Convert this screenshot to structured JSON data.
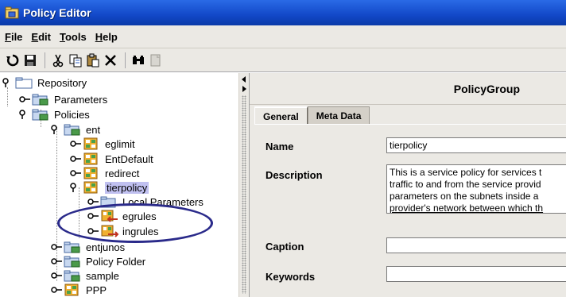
{
  "window": {
    "title": "Policy Editor"
  },
  "menu": [
    {
      "label": "File",
      "accel": "F",
      "rest": "ile"
    },
    {
      "label": "Edit",
      "accel": "E",
      "rest": "dit"
    },
    {
      "label": "Tools",
      "accel": "T",
      "rest": "ools"
    },
    {
      "label": "Help",
      "accel": "H",
      "rest": "elp"
    }
  ],
  "toolbar": {
    "buttons": [
      "refresh-icon",
      "save-icon",
      "cut-icon",
      "copy-icon",
      "paste-icon",
      "delete-icon",
      "find-icon",
      "properties-icon"
    ]
  },
  "tree": {
    "nodes": [
      {
        "label": "Repository",
        "icon": "folder-icon",
        "expanded": true
      },
      {
        "label": "Parameters",
        "icon": "folder-icon",
        "expanded": false
      },
      {
        "label": "Policies",
        "icon": "folder-icon",
        "expanded": true
      },
      {
        "label": "ent",
        "icon": "folder-icon",
        "expanded": true
      },
      {
        "label": "eglimit",
        "icon": "policy-icon",
        "expanded": false
      },
      {
        "label": "EntDefault",
        "icon": "policy-icon",
        "expanded": false
      },
      {
        "label": "redirect",
        "icon": "policy-icon",
        "expanded": false
      },
      {
        "label": "tierpolicy",
        "icon": "policy-icon",
        "expanded": true,
        "selected": true
      },
      {
        "label": "Local Parameters",
        "icon": "folder-icon",
        "expanded": false
      },
      {
        "label": "egrules",
        "icon": "rule-icon",
        "expanded": false
      },
      {
        "label": "ingrules",
        "icon": "rule-icon",
        "expanded": false
      },
      {
        "label": "entjunos",
        "icon": "folder-icon",
        "expanded": false
      },
      {
        "label": "Policy Folder",
        "icon": "folder-icon",
        "expanded": false
      },
      {
        "label": "sample",
        "icon": "folder-icon",
        "expanded": false
      },
      {
        "label": "PPP",
        "icon": "policy-icon",
        "expanded": false
      }
    ]
  },
  "panel": {
    "title": "PolicyGroup",
    "tabs": [
      {
        "label": "General",
        "active": true
      },
      {
        "label": "Meta Data",
        "active": false
      }
    ],
    "fields": {
      "name_label": "Name",
      "name_value": "tierpolicy",
      "description_label": "Description",
      "description_lines": [
        "This is a service policy for services t",
        "traffic to and from the service provid",
        "parameters on the subnets inside a",
        "provider's network between which th"
      ],
      "caption_label": "Caption",
      "caption_value": "",
      "keywords_label": "Keywords",
      "keywords_value": ""
    }
  },
  "colors": {
    "titlebar": "#1248c8",
    "selection": "#c0c0f0",
    "annotation": "#2a2a8a"
  }
}
